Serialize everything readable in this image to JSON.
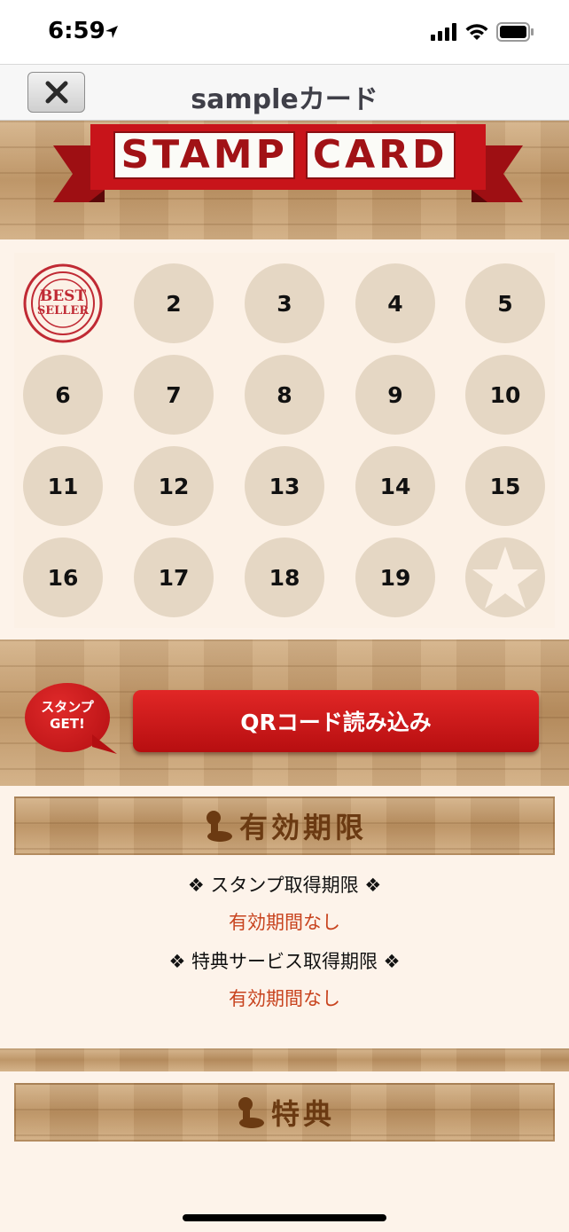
{
  "status_bar": {
    "time": "6:59"
  },
  "nav": {
    "title": "sampleカード",
    "close_label": "✕"
  },
  "banner": {
    "word1": "STAMP",
    "word2": "CARD"
  },
  "seal": {
    "top": "BEST SELLER",
    "main1": "BEST",
    "main2": "SELLER"
  },
  "stamps": [
    {
      "label": ""
    },
    {
      "label": "2"
    },
    {
      "label": "3"
    },
    {
      "label": "4"
    },
    {
      "label": "5"
    },
    {
      "label": "6"
    },
    {
      "label": "7"
    },
    {
      "label": "8"
    },
    {
      "label": "9"
    },
    {
      "label": "10"
    },
    {
      "label": "11"
    },
    {
      "label": "12"
    },
    {
      "label": "13"
    },
    {
      "label": "14"
    },
    {
      "label": "15"
    },
    {
      "label": "16"
    },
    {
      "label": "17"
    },
    {
      "label": "18"
    },
    {
      "label": "19"
    },
    {
      "label": ""
    }
  ],
  "qr": {
    "bubble_line1": "スタンプ",
    "bubble_line2": "GET!",
    "button_label": "QRコード読み込み"
  },
  "expiry": {
    "title": "有効期限",
    "stamp_label": "❖ スタンプ取得期限 ❖",
    "stamp_value": "有効期間なし",
    "benefit_label": "❖ 特典サービス取得期限 ❖",
    "benefit_value": "有効期間なし"
  },
  "benefits": {
    "title": "特典"
  },
  "colors": {
    "accent_red": "#c8141a",
    "expiry_text": "#c8431e",
    "header_brown": "#6b3a12",
    "stamp_slot": "#e5d7c4"
  }
}
